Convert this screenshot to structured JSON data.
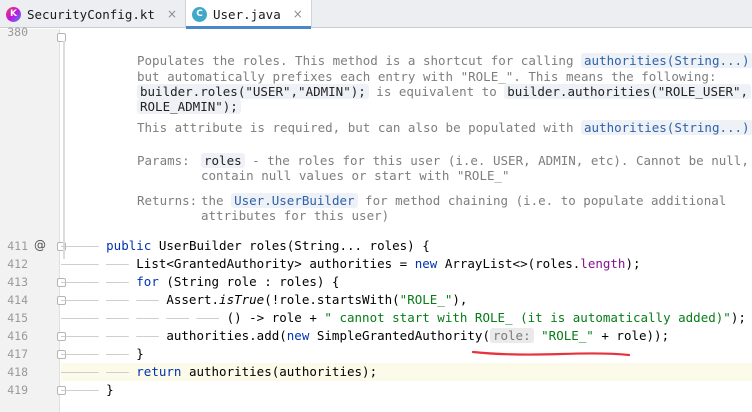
{
  "tabs": [
    {
      "label": "SecurityConfig.kt",
      "icon": "kotlin-file-icon",
      "glyph": "K",
      "active": false
    },
    {
      "label": "User.java",
      "icon": "java-class-icon",
      "glyph": "C",
      "active": true
    }
  ],
  "tab_close_glyph": "×",
  "gutter": {
    "line_numbers": [
      "380",
      "411",
      "412",
      "413",
      "414",
      "415",
      "416",
      "417",
      "418",
      "419"
    ],
    "override_marker": "@"
  },
  "javadoc": {
    "line1_a": "Populates the roles. This method is a shortcut for calling ",
    "line1_chip": "authorities(String...)",
    "line1_b": ",",
    "line2": "but automatically prefixes each entry with \"ROLE_\". This means the following:",
    "line3_chip1": "builder.roles(\"USER\",\"ADMIN\");",
    "line3_mid": " is equivalent to ",
    "line3_chip2": "builder.authorities(\"ROLE_USER\",",
    "line4_chip": "ROLE_ADMIN\");",
    "line5_a": "This attribute is required, but can also be populated with ",
    "line5_chip": "authorities(String...)",
    "line5_b": ".",
    "params_label": "Params:",
    "params_chip": "roles",
    "params_text1": " - the roles for this user (i.e. USER, ADMIN, etc). Cannot be null,",
    "params_text2": "contain null values or start with \"ROLE_\"",
    "returns_label": "Returns:",
    "returns_a": "the ",
    "returns_chip": "User.UserBuilder",
    "returns_b": " for method chaining (i.e. to populate additional",
    "returns_line2": "attributes for this user)"
  },
  "code": {
    "l411_guide": "————— ",
    "l411_kw": "public",
    "l411_rest": " UserBuilder roles(String... roles) {",
    "l412_guide": "————— ——— ",
    "l412_a": "List<GrantedAuthority> authorities = ",
    "l412_kw": "new",
    "l412_b": " ArrayList<>(roles.",
    "l412_fld": "length",
    "l412_c": ");",
    "l413_guide": "————— ——— ",
    "l413_kw": "for",
    "l413_rest": " (String role : roles) {",
    "l414_guide": "————— ——— ——— ",
    "l414_a": "Assert.",
    "l414_italic": "isTrue",
    "l414_b": "(!role.startsWith(",
    "l414_str": "\"ROLE_\"",
    "l414_c": "),",
    "l415_guide": "————— ——— ——— ——— ——— ",
    "l415_a": "() -> role + ",
    "l415_str": "\" cannot start with ROLE_ (it is automatically added)\"",
    "l415_b": ");",
    "l416_guide": "————— ——— ——— ",
    "l416_a": "authorities.add(",
    "l416_kw": "new",
    "l416_b": " SimpleGrantedAuthority(",
    "l416_hint": "role:",
    "l416_str": "\"ROLE_\"",
    "l416_c": " + role));",
    "l417_guide": "————— ——— ",
    "l417_rest": "}",
    "l418_guide": "————— ——— ",
    "l418_kw": "return",
    "l418_rest": " authorities(authorities);",
    "l419_guide": "————— ",
    "l419_rest": "}"
  },
  "colors": {
    "keyword": "#0033b3",
    "string": "#067d17",
    "field": "#871094",
    "squiggle": "#e8323c",
    "current_line": "#fcfae8"
  }
}
